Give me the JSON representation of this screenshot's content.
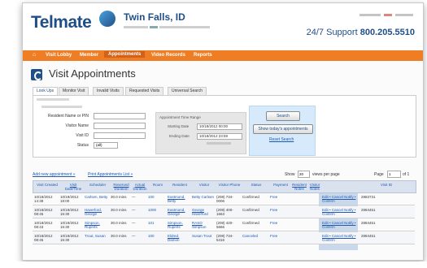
{
  "side_text": [
    "s",
    "e",
    "y",
    "s",
    "e",
    "d",
    ",",
    "e"
  ],
  "header": {
    "logo": "Telmate",
    "city": "Twin Falls, ID",
    "support_label": "24/7 Support",
    "support_number": "800.205.5510"
  },
  "nav": {
    "home_icon": "home-icon",
    "items": [
      "Visit Lobby",
      "Member",
      "Appointments",
      "Video Records",
      "Reports"
    ]
  },
  "page": {
    "title": "Visit Appointments",
    "tabs": [
      "Look Ups",
      "Monitor Visit",
      "Invalid Visits",
      "Requested Visits",
      "Universal Search"
    ]
  },
  "filter": {
    "field_labels": [
      "Resident Name or PIN",
      "Visitor Name",
      "Visit ID",
      "Status"
    ],
    "status_value": "(all)",
    "time_range_label": "Appointment Time Range",
    "starting_label": "Starting Date",
    "starting_value": "10/18/2012 00:00",
    "ending_label": "Ending Date",
    "ending_value": "10/18/2012 23:59",
    "search_button": "Search",
    "today_button": "Show today's appointments",
    "reset_link": "Reset Search"
  },
  "list": {
    "add_link": "Add new appointment »",
    "print_link": "Print Appointments List »",
    "show_label": "Show",
    "show_value": "20",
    "per_page_label": "views per page",
    "page_label": "Page",
    "page_value": "1",
    "of_label": "of 1"
  },
  "table": {
    "columns": [
      "Visit Created",
      "Visit Date/Time",
      "Scheduler",
      "Reserved Duration",
      "Actual Duration",
      "Room",
      "Resident",
      "Visitor",
      "Visitor Phone",
      "Status",
      "Payment",
      "Resident Notes",
      "Visitor Notes",
      "",
      "Visit ID"
    ],
    "rows": [
      [
        "10/18/2012 14:38",
        "10/19/2012 18:00",
        "Carlsen, Betty",
        "30.0 mins",
        "—",
        "100",
        "Eastmond, Betty",
        "Betty Carlsen",
        "(208) 734-0006",
        "Confirmed",
        "Free",
        "",
        "",
        "Edit • Cancel Notify • Confirm",
        "2883731"
      ],
      [
        "10/18/2012 08:45",
        "10/19/2012 15:30",
        "Haverford, George",
        "30.0 mins",
        "—",
        "1000",
        "Eastmond, George",
        "George Haverford",
        "(208) 400-1663",
        "Confirmed",
        "Free",
        "",
        "",
        "Edit • Cancel Notify • Confirm",
        "2884451"
      ],
      [
        "10/18/2012 08:43",
        "10/19/2012 15:30",
        "Simpson, Ruperts",
        "30.0 mins",
        "—",
        "101",
        "Simpson, Ruperts",
        "RASO Simpson",
        "(208) 420-5666",
        "Confirmed",
        "Free",
        "",
        "",
        "Edit • Cancel Notify • Confirm",
        "2884451"
      ],
      [
        "10/18/2012 08:45",
        "10/19/2012 15:30",
        "Trout, Susan",
        "30.0 mins",
        "—",
        "100",
        "Eldred, Damon",
        "Susan Trout",
        "(208) 734-5416",
        "Canceled",
        "Free",
        "",
        "",
        "Edit • Cancel Notify • Confirm",
        "2884451"
      ]
    ]
  }
}
